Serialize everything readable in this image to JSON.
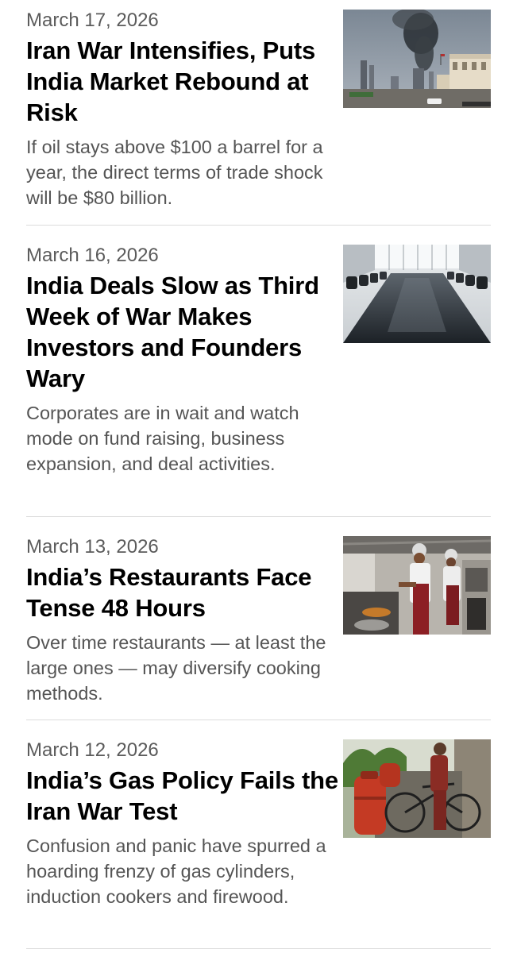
{
  "articles": [
    {
      "date": "March 17, 2026",
      "headline": "Iran War Intensifies, Puts India Market Rebound at Risk",
      "summary": "If oil stays above $100 a barrel for a year, the direct terms of trade shock will be $80 billion.",
      "image": "city-skyline-smoke-photo"
    },
    {
      "date": "March 16, 2026",
      "headline": "India Deals Slow as Third Week of War Makes Investors and Founders Wary",
      "summary": "Corporates are in wait and watch mode on fund raising, business expansion, and deal activities.",
      "image": "empty-boardroom-photo"
    },
    {
      "date": "March 13, 2026",
      "headline": "India’s Restaurants Face Tense 48 Hours",
      "summary": "Over time restaurants — at least the large ones — may diversify cooking methods.",
      "image": "restaurant-kitchen-cooks-photo"
    },
    {
      "date": "March 12, 2026",
      "headline": "India’s Gas Policy Fails the Iran War Test",
      "summary": "Confusion and panic have spurred a hoarding frenzy of gas cylinders, induction cookers and firewood.",
      "image": "gas-cylinders-bicycle-photo"
    }
  ]
}
